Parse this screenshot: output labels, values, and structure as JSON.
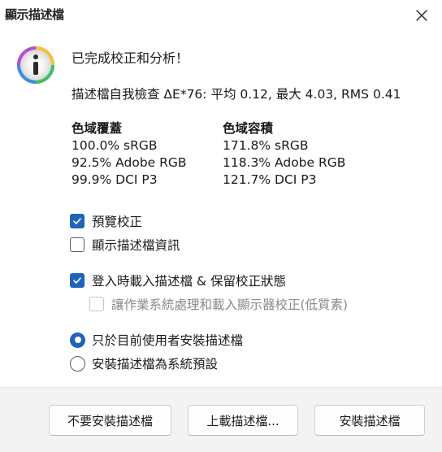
{
  "window": {
    "title": "顯示描述檔",
    "close_icon": "close-icon"
  },
  "status": {
    "headline": "已完成校正和分析！",
    "self_check": "描述檔自我檢查 ΔE*76: 平均 0.12, 最大 4.03, RMS 0.41"
  },
  "gamut": {
    "coverage": {
      "header": "色域覆蓋",
      "rows": [
        "100.0% sRGB",
        "92.5% Adobe RGB",
        "99.9% DCI P3"
      ]
    },
    "volume": {
      "header": "色域容積",
      "rows": [
        "171.8% sRGB",
        "118.3% Adobe RGB",
        "121.7% DCI P3"
      ]
    }
  },
  "options": {
    "preview_calibration": {
      "label": "預覽校正",
      "checked": true
    },
    "show_profile_info": {
      "label": "顯示描述檔資訊",
      "checked": false
    },
    "load_on_login": {
      "label": "登入時載入描述檔 & 保留校正狀態",
      "checked": true
    },
    "os_handle": {
      "label": "讓作業系統處理和載入顯示器校正(低質素)",
      "checked": false,
      "enabled": false
    }
  },
  "install_scope": {
    "current_user": {
      "label": "只於目前使用者安裝描述檔",
      "selected": true
    },
    "system_default": {
      "label": "安裝描述檔為系統預設",
      "selected": false
    }
  },
  "buttons": {
    "dont_install": "不要安裝描述檔",
    "upload": "上載描述檔...",
    "install": "安裝描述檔"
  },
  "colors": {
    "accent": "#1f64b9",
    "footer_bg": "#f3f3f3"
  }
}
